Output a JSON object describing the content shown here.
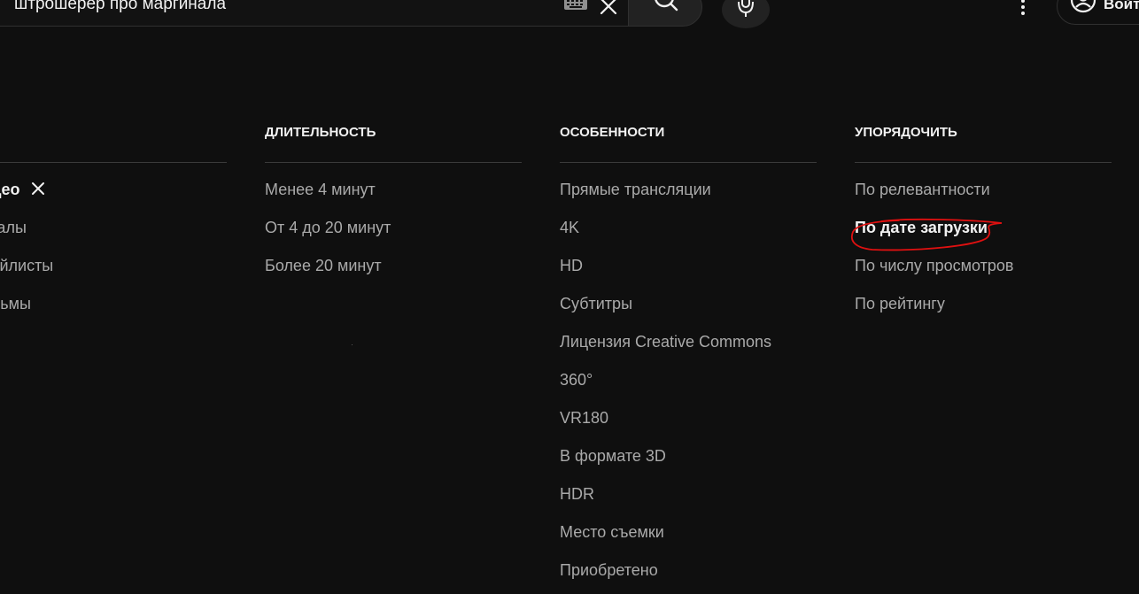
{
  "header": {
    "search_query": "штрошерер про маргинала",
    "signin_label": "Войти",
    "icons": {
      "keyboard": "keyboard-icon",
      "clear": "close-icon",
      "search": "search-icon",
      "mic": "microphone-icon",
      "more": "more-vertical-icon",
      "account": "account-circle-icon"
    }
  },
  "filters": {
    "type": {
      "items": [
        {
          "label": "Видео",
          "selected": true
        },
        {
          "label": "Каналы",
          "selected": false
        },
        {
          "label": "Плейлисты",
          "selected": false
        },
        {
          "label": "Фильмы",
          "selected": false
        }
      ]
    },
    "duration": {
      "heading": "Длительность",
      "items": [
        {
          "label": "Менее 4 минут"
        },
        {
          "label": "От 4 до 20 минут"
        },
        {
          "label": "Более 20 минут"
        }
      ]
    },
    "features": {
      "heading": "Особенности",
      "items": [
        {
          "label": "Прямые трансляции"
        },
        {
          "label": "4K"
        },
        {
          "label": "HD"
        },
        {
          "label": "Субтитры"
        },
        {
          "label": "Лицензия Creative Commons"
        },
        {
          "label": "360°"
        },
        {
          "label": "VR180"
        },
        {
          "label": "В формате 3D"
        },
        {
          "label": "HDR"
        },
        {
          "label": "Место съемки"
        },
        {
          "label": "Приобретено"
        }
      ]
    },
    "sort": {
      "heading": "Упорядочить",
      "items": [
        {
          "label": "По релевантности",
          "selected": false
        },
        {
          "label": "По дате загрузки",
          "selected": true
        },
        {
          "label": "По числу просмотров",
          "selected": false
        },
        {
          "label": "По рейтингу",
          "selected": false
        }
      ]
    }
  },
  "colors": {
    "background": "#0f0f0f",
    "text_primary": "#f1f1f1",
    "text_secondary": "#aaaaaa",
    "annotation": "#e01010"
  }
}
